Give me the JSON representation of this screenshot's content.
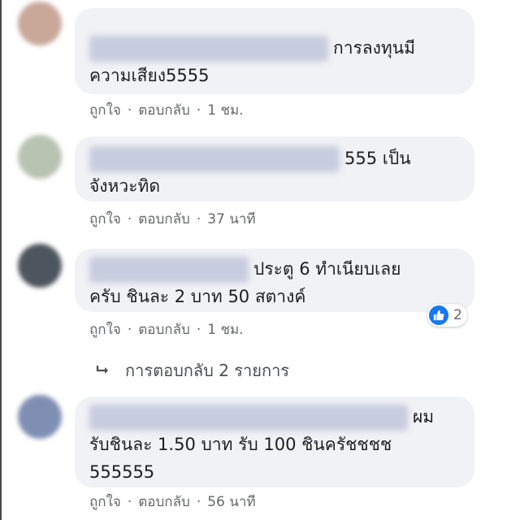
{
  "colors": {
    "bubble": "#f0f2f5",
    "meta_text": "#65676b",
    "like_blue": "#1877f2"
  },
  "comments": [
    {
      "text_lines": [
        "การลงทุนมี",
        "ความเสียง5555"
      ],
      "actions": {
        "like": "ถูกใจ",
        "reply": "ตอบกลับ",
        "time": "1 ชม."
      }
    },
    {
      "text_lines": [
        "555 เป็น",
        "จังหวะทิด"
      ],
      "actions": {
        "like": "ถูกใจ",
        "reply": "ตอบกลับ",
        "time": "37 นาที"
      }
    },
    {
      "text_lines": [
        "ประตู 6 ทำเนียบเลย",
        "ครับ ชินละ 2 บาท 50 สตางค์"
      ],
      "reaction": {
        "icon": "thumbs-up-icon",
        "count": "2"
      },
      "actions": {
        "like": "ถูกใจ",
        "reply": "ตอบกลับ",
        "time": "1 ชม."
      }
    },
    {
      "text_lines": [
        "ผม",
        "รับชินละ 1.50 บาท รับ 100 ชินครัชชชช",
        "555555"
      ],
      "actions": {
        "like": "ถูกใจ",
        "reply": "ตอบกลับ",
        "time": "56 นาที"
      }
    }
  ],
  "replies_link": {
    "icon": "reply-arrow-icon",
    "label": "การตอบกลับ 2 รายการ"
  },
  "separator": "·"
}
